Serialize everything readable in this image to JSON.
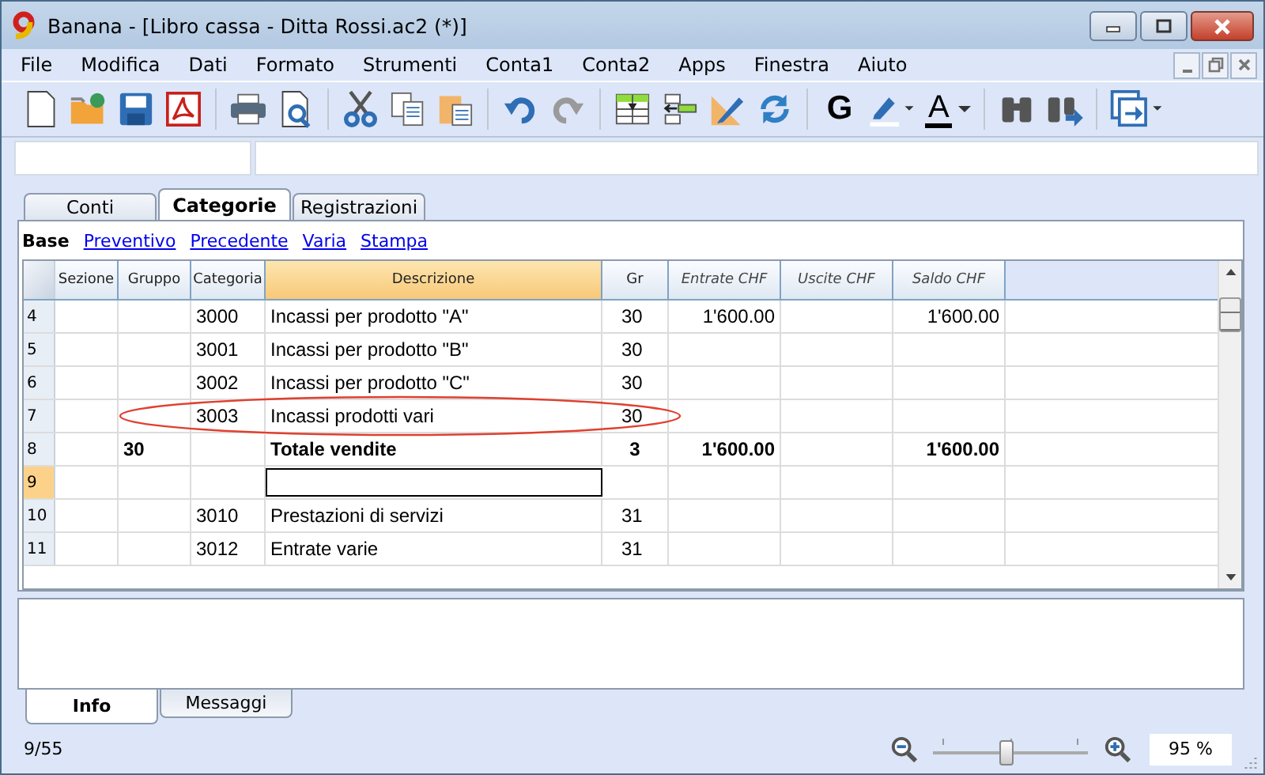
{
  "window": {
    "title": "Banana - [Libro cassa - Ditta Rossi.ac2 (*)]"
  },
  "menu": [
    "File",
    "Modifica",
    "Dati",
    "Formato",
    "Strumenti",
    "Conta1",
    "Conta2",
    "Apps",
    "Finestra",
    "Aiuto"
  ],
  "toolbar": {
    "bold_glyph": "G",
    "font_color_glyph": "A"
  },
  "tabs": [
    {
      "label": "Conti",
      "selected": false
    },
    {
      "label": "Categorie",
      "selected": true
    },
    {
      "label": "Registrazioni",
      "selected": false
    }
  ],
  "views": [
    {
      "label": "Base",
      "selected": true
    },
    {
      "label": "Preventivo",
      "selected": false
    },
    {
      "label": "Precedente",
      "selected": false
    },
    {
      "label": "Varia",
      "selected": false
    },
    {
      "label": "Stampa",
      "selected": false
    }
  ],
  "table": {
    "columns": [
      {
        "label": "Sezione",
        "selected": false
      },
      {
        "label": "Gruppo",
        "selected": false
      },
      {
        "label": "Categoria",
        "selected": false
      },
      {
        "label": "Descrizione",
        "selected": true
      },
      {
        "label": "Gr",
        "selected": false
      },
      {
        "label": "Entrate CHF",
        "selected": false
      },
      {
        "label": "Uscite CHF",
        "selected": false
      },
      {
        "label": "Saldo CHF",
        "selected": false
      }
    ],
    "rows": [
      {
        "number": "4",
        "kind": "account",
        "selected": false,
        "circled": false,
        "categoria": "3000",
        "descrizione": "Incassi per prodotto \"A\"",
        "gr": "30",
        "entrate": "1'600.00",
        "saldo": "1'600.00"
      },
      {
        "number": "5",
        "kind": "account",
        "selected": false,
        "circled": false,
        "categoria": "3001",
        "descrizione": "Incassi per prodotto \"B\"",
        "gr": "30"
      },
      {
        "number": "6",
        "kind": "account",
        "selected": false,
        "circled": false,
        "categoria": "3002",
        "descrizione": "Incassi per prodotto \"C\"",
        "gr": "30"
      },
      {
        "number": "7",
        "kind": "account",
        "selected": false,
        "circled": true,
        "categoria": "3003",
        "descrizione": "Incassi prodotti vari",
        "gr": "30"
      },
      {
        "number": "8",
        "kind": "total",
        "selected": false,
        "circled": false,
        "gruppo": "30",
        "descrizione": "Totale vendite",
        "gr": "3",
        "entrate": "1'600.00",
        "saldo": "1'600.00"
      },
      {
        "number": "9",
        "kind": "empty",
        "selected": true,
        "circled": false
      },
      {
        "number": "10",
        "kind": "account",
        "selected": false,
        "circled": false,
        "categoria": "3010",
        "descrizione": "Prestazioni di servizi",
        "gr": "31"
      },
      {
        "number": "11",
        "kind": "account",
        "selected": false,
        "circled": false,
        "categoria": "3012",
        "descrizione": "Entrate varie",
        "gr": "31"
      }
    ]
  },
  "info_tabs": [
    {
      "label": "Info",
      "selected": true
    },
    {
      "label": "Messaggi",
      "selected": false
    }
  ],
  "status": {
    "position": "9/55",
    "zoom": {
      "level": 0.48,
      "value": "95 %"
    }
  }
}
